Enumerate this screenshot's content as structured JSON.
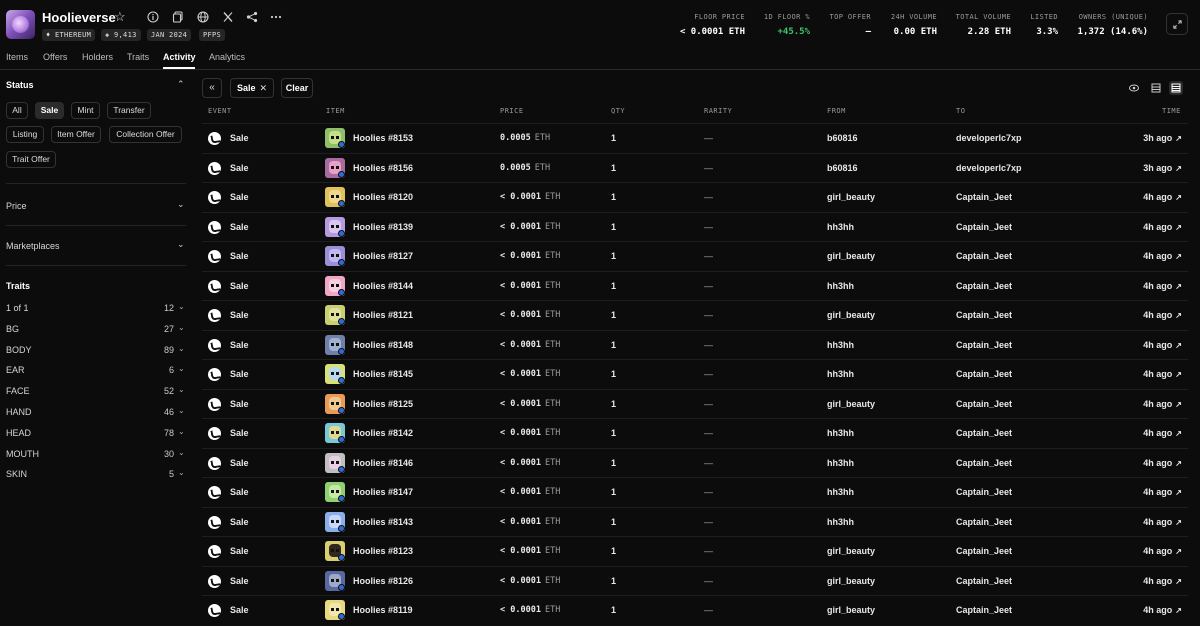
{
  "collection": {
    "name": "Hoolieverse",
    "chips": [
      "♦ ETHEREUM",
      "◈ 9,413",
      "JAN 2024",
      "PFPS"
    ]
  },
  "stats": [
    {
      "label": "FLOOR PRICE",
      "value": "< 0.0001 ETH"
    },
    {
      "label": "1D FLOOR %",
      "value": "+45.5%"
    },
    {
      "label": "TOP OFFER",
      "value": "–"
    },
    {
      "label": "24H VOLUME",
      "value": "0.00 ETH"
    },
    {
      "label": "TOTAL VOLUME",
      "value": "2.28 ETH"
    },
    {
      "label": "LISTED",
      "value": "3.3%"
    },
    {
      "label": "OWNERS (UNIQUE)",
      "value": "1,372 (14.6%)"
    }
  ],
  "tabs": [
    "Items",
    "Offers",
    "Holders",
    "Traits",
    "Activity",
    "Analytics"
  ],
  "sidebar": {
    "status_title": "Status",
    "status_filters": [
      "All",
      "Sale",
      "Mint",
      "Transfer",
      "Listing",
      "Item Offer",
      "Collection Offer",
      "Trait Offer"
    ],
    "price_title": "Price",
    "marketplaces_title": "Marketplaces",
    "traits_title": "Traits",
    "traits": [
      {
        "name": "1 of 1",
        "count": "12"
      },
      {
        "name": "BG",
        "count": "27"
      },
      {
        "name": "BODY",
        "count": "89"
      },
      {
        "name": "EAR",
        "count": "6"
      },
      {
        "name": "FACE",
        "count": "52"
      },
      {
        "name": "HAND",
        "count": "46"
      },
      {
        "name": "HEAD",
        "count": "78"
      },
      {
        "name": "MOUTH",
        "count": "30"
      },
      {
        "name": "SKIN",
        "count": "5"
      }
    ]
  },
  "toolbar": {
    "collapse_glyph": "«",
    "filter_chip": "Sale",
    "filter_close": "✕",
    "clear": "Clear"
  },
  "table": {
    "columns": [
      "EVENT",
      "ITEM",
      "PRICE",
      "QTY",
      "RARITY",
      "FROM",
      "TO",
      "TIME"
    ],
    "rows": [
      {
        "event": "Sale",
        "item": "Hoolies #8153",
        "price": "0.0005",
        "unit": "ETH",
        "qty": "1",
        "rarity": "—",
        "from": "b60816",
        "to": "developerlc7xp",
        "time": "3h ago",
        "thumb_bg": "#8fbf6b",
        "thumb_face": "#c8e08a"
      },
      {
        "event": "Sale",
        "item": "Hoolies #8156",
        "price": "0.0005",
        "unit": "ETH",
        "qty": "1",
        "rarity": "—",
        "from": "b60816",
        "to": "developerlc7xp",
        "time": "3h ago",
        "thumb_bg": "#a86b9e",
        "thumb_face": "#e8a0c8"
      },
      {
        "event": "Sale",
        "item": "Hoolies #8120",
        "price": "< 0.0001",
        "unit": "ETH",
        "qty": "1",
        "rarity": "—",
        "from": "girl_beauty",
        "to": "Captain_Jeet",
        "time": "4h ago",
        "thumb_bg": "#e0c25a",
        "thumb_face": "#f0d890"
      },
      {
        "event": "Sale",
        "item": "Hoolies #8139",
        "price": "< 0.0001",
        "unit": "ETH",
        "qty": "1",
        "rarity": "—",
        "from": "hh3hh",
        "to": "Captain_Jeet",
        "time": "4h ago",
        "thumb_bg": "#b59ae0",
        "thumb_face": "#d8c8f0"
      },
      {
        "event": "Sale",
        "item": "Hoolies #8127",
        "price": "< 0.0001",
        "unit": "ETH",
        "qty": "1",
        "rarity": "—",
        "from": "girl_beauty",
        "to": "Captain_Jeet",
        "time": "4h ago",
        "thumb_bg": "#9a8fd8",
        "thumb_face": "#c0b8ee"
      },
      {
        "event": "Sale",
        "item": "Hoolies #8144",
        "price": "< 0.0001",
        "unit": "ETH",
        "qty": "1",
        "rarity": "—",
        "from": "hh3hh",
        "to": "Captain_Jeet",
        "time": "4h ago",
        "thumb_bg": "#f0a8c8",
        "thumb_face": "#f8d0e0"
      },
      {
        "event": "Sale",
        "item": "Hoolies #8121",
        "price": "< 0.0001",
        "unit": "ETH",
        "qty": "1",
        "rarity": "—",
        "from": "girl_beauty",
        "to": "Captain_Jeet",
        "time": "4h ago",
        "thumb_bg": "#c8d070",
        "thumb_face": "#e0e0a0"
      },
      {
        "event": "Sale",
        "item": "Hoolies #8148",
        "price": "< 0.0001",
        "unit": "ETH",
        "qty": "1",
        "rarity": "—",
        "from": "hh3hh",
        "to": "Captain_Jeet",
        "time": "4h ago",
        "thumb_bg": "#7080a8",
        "thumb_face": "#a0b0d0"
      },
      {
        "event": "Sale",
        "item": "Hoolies #8145",
        "price": "< 0.0001",
        "unit": "ETH",
        "qty": "1",
        "rarity": "—",
        "from": "hh3hh",
        "to": "Captain_Jeet",
        "time": "4h ago",
        "thumb_bg": "#d8e078",
        "thumb_face": "#b8d8f0"
      },
      {
        "event": "Sale",
        "item": "Hoolies #8125",
        "price": "< 0.0001",
        "unit": "ETH",
        "qty": "1",
        "rarity": "—",
        "from": "girl_beauty",
        "to": "Captain_Jeet",
        "time": "4h ago",
        "thumb_bg": "#e89a58",
        "thumb_face": "#f0c890"
      },
      {
        "event": "Sale",
        "item": "Hoolies #8142",
        "price": "< 0.0001",
        "unit": "ETH",
        "qty": "1",
        "rarity": "—",
        "from": "hh3hh",
        "to": "Captain_Jeet",
        "time": "4h ago",
        "thumb_bg": "#78c8d8",
        "thumb_face": "#e0d890"
      },
      {
        "event": "Sale",
        "item": "Hoolies #8146",
        "price": "< 0.0001",
        "unit": "ETH",
        "qty": "1",
        "rarity": "—",
        "from": "hh3hh",
        "to": "Captain_Jeet",
        "time": "4h ago",
        "thumb_bg": "#c0c0c0",
        "thumb_face": "#e8d0e0"
      },
      {
        "event": "Sale",
        "item": "Hoolies #8147",
        "price": "< 0.0001",
        "unit": "ETH",
        "qty": "1",
        "rarity": "—",
        "from": "hh3hh",
        "to": "Captain_Jeet",
        "time": "4h ago",
        "thumb_bg": "#90d070",
        "thumb_face": "#c8e8a8"
      },
      {
        "event": "Sale",
        "item": "Hoolies #8143",
        "price": "< 0.0001",
        "unit": "ETH",
        "qty": "1",
        "rarity": "—",
        "from": "hh3hh",
        "to": "Captain_Jeet",
        "time": "4h ago",
        "thumb_bg": "#8ab0e8",
        "thumb_face": "#c8d8f8"
      },
      {
        "event": "Sale",
        "item": "Hoolies #8123",
        "price": "< 0.0001",
        "unit": "ETH",
        "qty": "1",
        "rarity": "—",
        "from": "girl_beauty",
        "to": "Captain_Jeet",
        "time": "4h ago",
        "thumb_bg": "#d8d070",
        "thumb_face": "#302820"
      },
      {
        "event": "Sale",
        "item": "Hoolies #8126",
        "price": "< 0.0001",
        "unit": "ETH",
        "qty": "1",
        "rarity": "—",
        "from": "girl_beauty",
        "to": "Captain_Jeet",
        "time": "4h ago",
        "thumb_bg": "#5868a0",
        "thumb_face": "#a0a8c8"
      },
      {
        "event": "Sale",
        "item": "Hoolies #8119",
        "price": "< 0.0001",
        "unit": "ETH",
        "qty": "1",
        "rarity": "—",
        "from": "girl_beauty",
        "to": "Captain_Jeet",
        "time": "4h ago",
        "thumb_bg": "#e8d880",
        "thumb_face": "#f0e8b0"
      }
    ]
  },
  "icons": {
    "star": "☆",
    "chevron_up": "⌃",
    "chevron_down": "⌄",
    "external_arrow": "↗"
  },
  "colors": {
    "positive": "#3fc26b",
    "background": "#0c0c0c",
    "badge": "#2e6bd9"
  }
}
